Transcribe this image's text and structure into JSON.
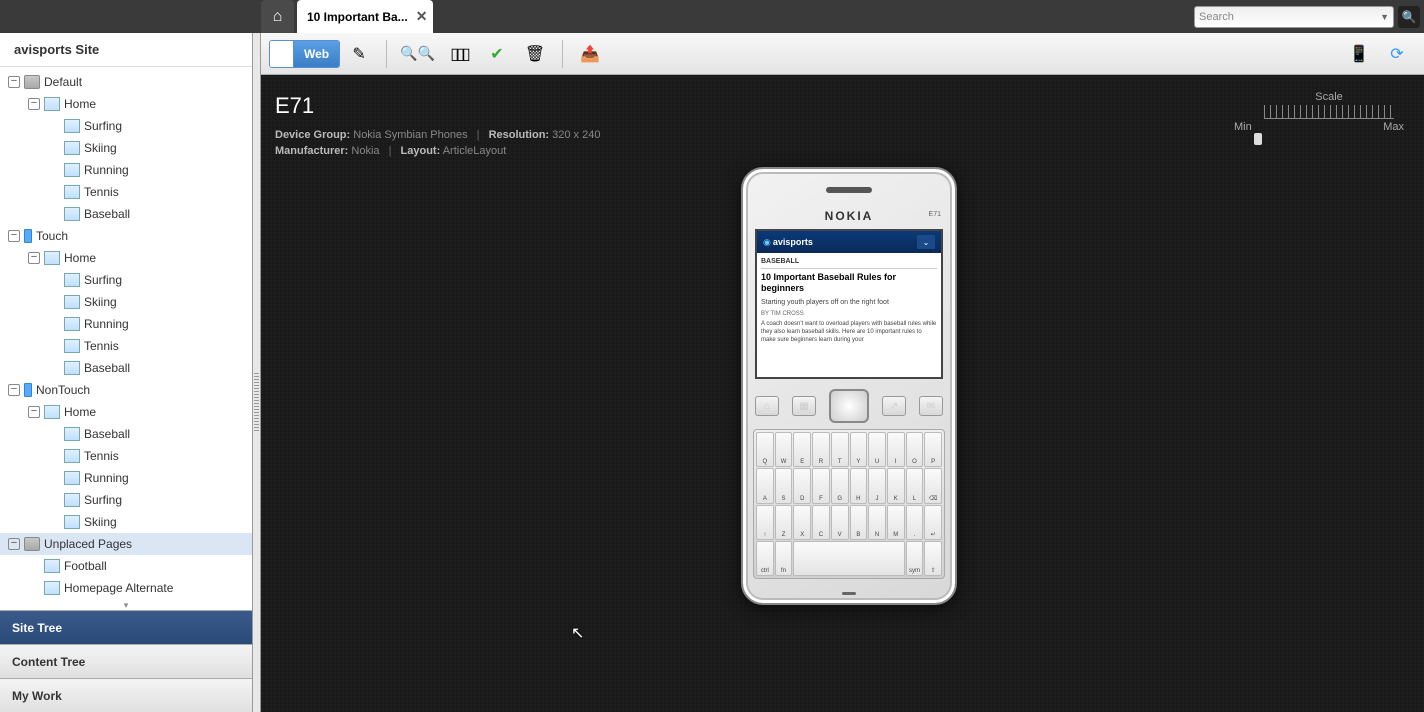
{
  "topbar": {
    "tab_title": "10 Important Ba...",
    "search_placeholder": "Search"
  },
  "sidebar": {
    "title": "avisports Site",
    "panels": {
      "site_tree": "Site Tree",
      "content_tree": "Content Tree",
      "my_work": "My Work"
    },
    "tree": [
      {
        "label": "Default",
        "depth": 0,
        "icon": "folder",
        "expanded": true,
        "name": "node-default"
      },
      {
        "label": "Home",
        "depth": 1,
        "icon": "page",
        "expanded": true,
        "name": "node-default-home"
      },
      {
        "label": "Surfing",
        "depth": 2,
        "icon": "page",
        "name": "node-default-surfing"
      },
      {
        "label": "Skiing",
        "depth": 2,
        "icon": "page",
        "name": "node-default-skiing"
      },
      {
        "label": "Running",
        "depth": 2,
        "icon": "page",
        "name": "node-default-running"
      },
      {
        "label": "Tennis",
        "depth": 2,
        "icon": "page",
        "name": "node-default-tennis"
      },
      {
        "label": "Baseball",
        "depth": 2,
        "icon": "page",
        "name": "node-default-baseball"
      },
      {
        "label": "Touch",
        "depth": 0,
        "icon": "device",
        "expanded": true,
        "name": "node-touch"
      },
      {
        "label": "Home",
        "depth": 1,
        "icon": "page",
        "expanded": true,
        "name": "node-touch-home"
      },
      {
        "label": "Surfing",
        "depth": 2,
        "icon": "page",
        "name": "node-touch-surfing"
      },
      {
        "label": "Skiing",
        "depth": 2,
        "icon": "page",
        "name": "node-touch-skiing"
      },
      {
        "label": "Running",
        "depth": 2,
        "icon": "page",
        "name": "node-touch-running"
      },
      {
        "label": "Tennis",
        "depth": 2,
        "icon": "page",
        "name": "node-touch-tennis"
      },
      {
        "label": "Baseball",
        "depth": 2,
        "icon": "page",
        "name": "node-touch-baseball"
      },
      {
        "label": "NonTouch",
        "depth": 0,
        "icon": "device",
        "expanded": true,
        "name": "node-nontouch"
      },
      {
        "label": "Home",
        "depth": 1,
        "icon": "page",
        "expanded": true,
        "name": "node-nontouch-home"
      },
      {
        "label": "Baseball",
        "depth": 2,
        "icon": "page",
        "name": "node-nontouch-baseball"
      },
      {
        "label": "Tennis",
        "depth": 2,
        "icon": "page",
        "name": "node-nontouch-tennis"
      },
      {
        "label": "Running",
        "depth": 2,
        "icon": "page",
        "name": "node-nontouch-running"
      },
      {
        "label": "Surfing",
        "depth": 2,
        "icon": "page",
        "name": "node-nontouch-surfing"
      },
      {
        "label": "Skiing",
        "depth": 2,
        "icon": "page",
        "name": "node-nontouch-skiing"
      },
      {
        "label": "Unplaced Pages",
        "depth": 0,
        "icon": "folder",
        "expanded": true,
        "selected": true,
        "name": "node-unplaced"
      },
      {
        "label": "Football",
        "depth": 1,
        "icon": "page",
        "name": "node-football"
      },
      {
        "label": "Homepage Alternate",
        "depth": 1,
        "icon": "page",
        "name": "node-homepage-alt"
      }
    ]
  },
  "toolbar": {
    "web_label": "Web"
  },
  "preview": {
    "device": "E71",
    "meta": {
      "device_group_label": "Device Group:",
      "device_group": "Nokia Symbian Phones",
      "resolution_label": "Resolution:",
      "resolution": "320 x 240",
      "manufacturer_label": "Manufacturer:",
      "manufacturer": "Nokia",
      "layout_label": "Layout:",
      "layout": "ArticleLayout"
    },
    "scale": {
      "title": "Scale",
      "min": "Min",
      "max": "Max"
    }
  },
  "phone": {
    "brand": "NOKIA",
    "model": "E71",
    "site_brand": "avisports",
    "category": "BASEBALL",
    "article_title": "10 Important Baseball Rules for beginners",
    "subheading": "Starting youth players off on the right foot",
    "byline": "BY TIM CROSS",
    "body": "A coach doesn't want to overload players with baseball rules while they also learn baseball skills. Here are 10 important rules to make sure beginners learn during your",
    "keys_r1": [
      "Q",
      "W",
      "E",
      "R",
      "T",
      "Y",
      "U",
      "I",
      "O",
      "P"
    ],
    "keys_r2": [
      "A",
      "S",
      "D",
      "F",
      "G",
      "H",
      "J",
      "K",
      "L",
      "⌫"
    ],
    "keys_r3": [
      "↑",
      "Z",
      "X",
      "C",
      "V",
      "B",
      "N",
      "M",
      ".",
      "↵"
    ]
  }
}
